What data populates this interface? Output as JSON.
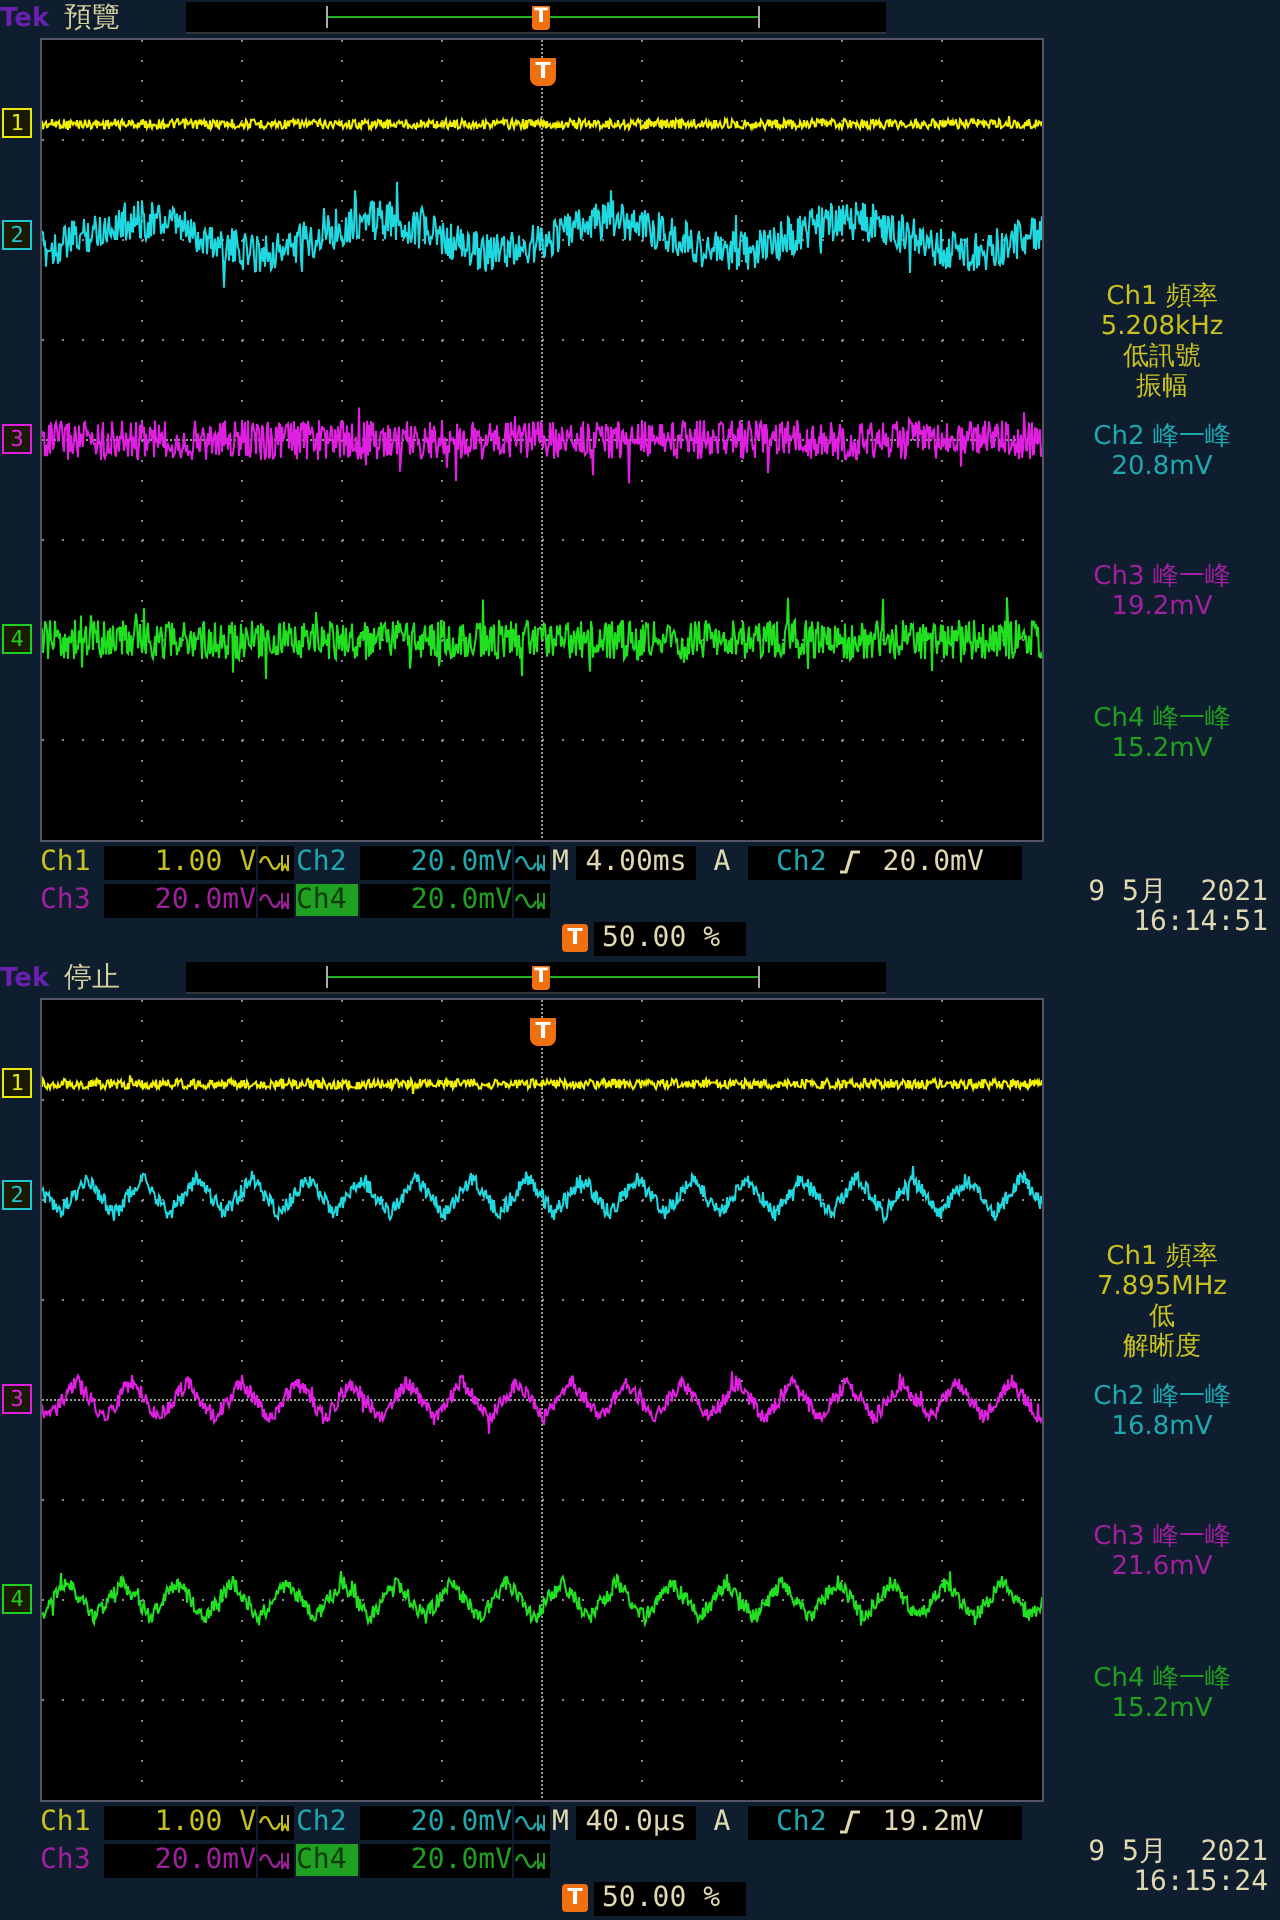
{
  "panels": [
    {
      "header": {
        "brand": "Tek",
        "status": "預覽",
        "trigger_marker": "T"
      },
      "display": {
        "trigger_marker": "T",
        "channel_markers": [
          {
            "label": "1",
            "color": "#e8e800"
          },
          {
            "label": "2",
            "color": "#20c8d0"
          },
          {
            "label": "3",
            "color": "#e020e0"
          },
          {
            "label": "4",
            "color": "#20d020"
          }
        ],
        "traces": [
          {
            "kind": "flat",
            "color": "#f0f000"
          },
          {
            "kind": "slow-wave",
            "color": "#20d8e0"
          },
          {
            "kind": "noise",
            "color": "#e020e0"
          },
          {
            "kind": "noise",
            "color": "#20e020"
          }
        ]
      },
      "readouts": [
        {
          "lines": [
            "Ch1 頻率",
            "5.208kHz",
            "低訊號",
            "振幅"
          ],
          "color": "#c8c020"
        },
        {
          "lines": [
            "Ch2 峰一峰",
            "20.8mV"
          ],
          "color": "#20a8b0"
        },
        {
          "lines": [
            "Ch3 峰一峰",
            "19.2mV"
          ],
          "color": "#a020a0"
        },
        {
          "lines": [
            "Ch4 峰一峰",
            "15.2mV"
          ],
          "color": "#20a020"
        }
      ],
      "channel_settings": [
        {
          "label": "Ch1",
          "value": "1.00 V",
          "color": "#c8c020",
          "selected": false
        },
        {
          "label": "Ch2",
          "value": "20.0mV",
          "color": "#20a8b0",
          "selected": false
        },
        {
          "label": "Ch3",
          "value": "20.0mV",
          "color": "#a020a0",
          "selected": false
        },
        {
          "label": "Ch4",
          "value": "20.0mV",
          "color": "#20a020",
          "selected": true
        }
      ],
      "timebase": {
        "label": "M",
        "value": "4.00ms"
      },
      "trigger": {
        "label": "A",
        "source": "Ch2",
        "level": "20.0mV"
      },
      "trigger_position": {
        "icon": "T",
        "value": "50.00 %"
      },
      "date": "9 5月  2021",
      "time": "16:14:51"
    },
    {
      "header": {
        "brand": "Tek",
        "status": "停止",
        "trigger_marker": "T"
      },
      "display": {
        "trigger_marker": "T",
        "channel_markers": [
          {
            "label": "1",
            "color": "#e8e800"
          },
          {
            "label": "2",
            "color": "#20c8d0"
          },
          {
            "label": "3",
            "color": "#e020e0"
          },
          {
            "label": "4",
            "color": "#20d020"
          }
        ],
        "traces": [
          {
            "kind": "flat",
            "color": "#f0f000"
          },
          {
            "kind": "fast-wave",
            "color": "#20d8e0"
          },
          {
            "kind": "fast-wave",
            "color": "#e020e0"
          },
          {
            "kind": "fast-wave",
            "color": "#20e020"
          }
        ]
      },
      "readouts": [
        {
          "lines": [
            "Ch1 頻率",
            "7.895MHz",
            "低",
            "解晰度"
          ],
          "color": "#c8c020"
        },
        {
          "lines": [
            "Ch2 峰一峰",
            "16.8mV"
          ],
          "color": "#20a8b0"
        },
        {
          "lines": [
            "Ch3 峰一峰",
            "21.6mV"
          ],
          "color": "#a020a0"
        },
        {
          "lines": [
            "Ch4 峰一峰",
            "15.2mV"
          ],
          "color": "#20a020"
        }
      ],
      "channel_settings": [
        {
          "label": "Ch1",
          "value": "1.00 V",
          "color": "#c8c020",
          "selected": false
        },
        {
          "label": "Ch2",
          "value": "20.0mV",
          "color": "#20a8b0",
          "selected": false
        },
        {
          "label": "Ch3",
          "value": "20.0mV",
          "color": "#a020a0",
          "selected": false
        },
        {
          "label": "Ch4",
          "value": "20.0mV",
          "color": "#20a020",
          "selected": true
        }
      ],
      "timebase": {
        "label": "M",
        "value": "40.0µs"
      },
      "trigger": {
        "label": "A",
        "source": "Ch2",
        "level": "19.2mV"
      },
      "trigger_position": {
        "icon": "T",
        "value": "50.00 %"
      },
      "date": "9 5月  2021",
      "time": "16:15:24"
    }
  ]
}
